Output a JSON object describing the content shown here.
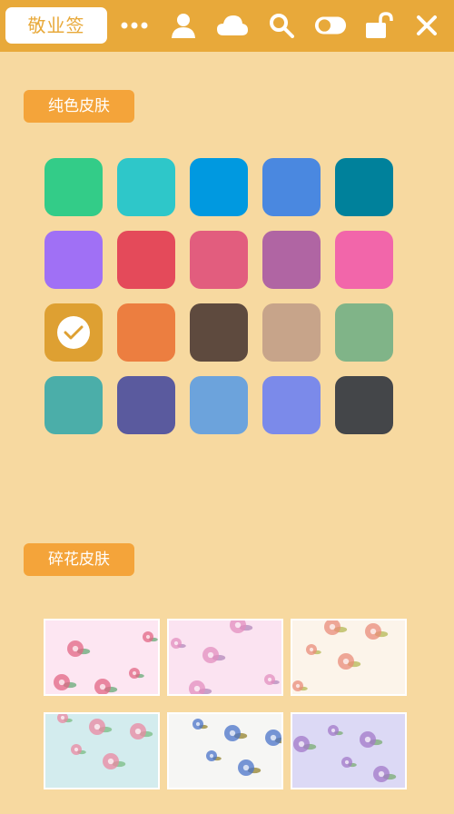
{
  "titlebar": {
    "app_title": "敬业签",
    "icons": [
      "more-icon",
      "user-icon",
      "cloud-icon",
      "search-icon",
      "toggle-icon",
      "unlock-icon",
      "close-icon"
    ]
  },
  "solid_section": {
    "label": "纯色皮肤",
    "selected_index": 10,
    "swatches": [
      "#33cc88",
      "#2ec7c9",
      "#0099e0",
      "#4a88e0",
      "#00819b",
      "#a070f5",
      "#e44a5a",
      "#e25d7e",
      "#b065a3",
      "#f266aa",
      "#dea032",
      "#ec7e40",
      "#5e4a3e",
      "#c7a48a",
      "#80b488",
      "#4baea9",
      "#5a5a9e",
      "#6ca3dc",
      "#7b8aea",
      "#444649"
    ]
  },
  "floral_section": {
    "label": "碎花皮肤",
    "patterns": [
      {
        "bg": "#fde6f2",
        "flower": "#e26684",
        "leaf": "#6fae7e"
      },
      {
        "bg": "#fbe3f1",
        "flower": "#e38fbf",
        "leaf": "#b98fbf"
      },
      {
        "bg": "#fcf4ea",
        "flower": "#e98c7a",
        "leaf": "#b9bb5e"
      },
      {
        "bg": "#d3ecee",
        "flower": "#eb88a2",
        "leaf": "#7fbf8a"
      },
      {
        "bg": "#f6f6f4",
        "flower": "#4a73c9",
        "leaf": "#9a8a3a"
      },
      {
        "bg": "#dcd9f5",
        "flower": "#a378c8",
        "leaf": "#7fae7a"
      }
    ]
  }
}
